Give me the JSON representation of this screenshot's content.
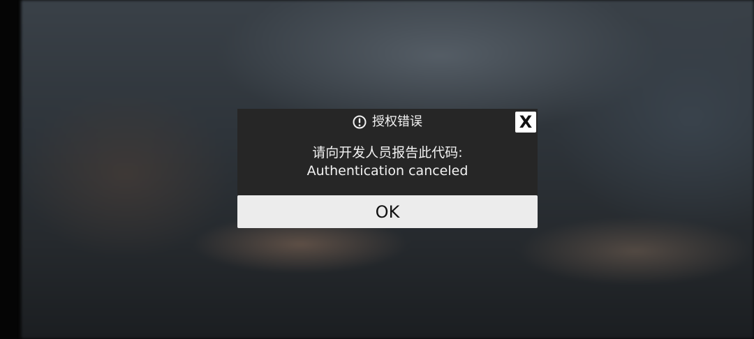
{
  "dialog": {
    "title": "授权错误",
    "title_icon": "alert-circle-icon",
    "close_label": "X",
    "message_line1": "请向开发人员报告此代码:",
    "message_line2": "Authentication canceled",
    "ok_label": "OK"
  },
  "colors": {
    "dialog_background": "#262626",
    "button_background": "#ececec",
    "text_light": "#f2f2f2",
    "text_dark": "#111111"
  }
}
